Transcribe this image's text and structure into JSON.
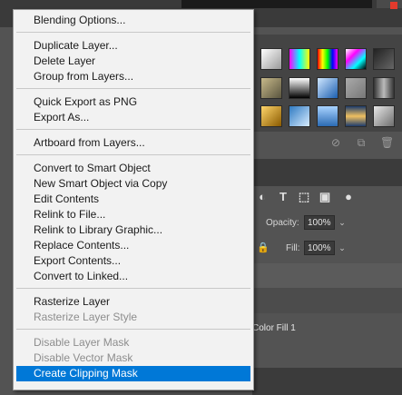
{
  "menu": {
    "groups": [
      [
        {
          "label": "Blending Options...",
          "enabled": true
        }
      ],
      [
        {
          "label": "Duplicate Layer...",
          "enabled": true
        },
        {
          "label": "Delete Layer",
          "enabled": true
        },
        {
          "label": "Group from Layers...",
          "enabled": true
        }
      ],
      [
        {
          "label": "Quick Export as PNG",
          "enabled": true
        },
        {
          "label": "Export As...",
          "enabled": true
        }
      ],
      [
        {
          "label": "Artboard from Layers...",
          "enabled": true
        }
      ],
      [
        {
          "label": "Convert to Smart Object",
          "enabled": true
        },
        {
          "label": "New Smart Object via Copy",
          "enabled": true
        },
        {
          "label": "Edit Contents",
          "enabled": true
        },
        {
          "label": "Relink to File...",
          "enabled": true
        },
        {
          "label": "Relink to Library Graphic...",
          "enabled": true
        },
        {
          "label": "Replace Contents...",
          "enabled": true
        },
        {
          "label": "Export Contents...",
          "enabled": true
        },
        {
          "label": "Convert to Linked...",
          "enabled": true
        }
      ],
      [
        {
          "label": "Rasterize Layer",
          "enabled": true
        },
        {
          "label": "Rasterize Layer Style",
          "enabled": false
        }
      ],
      [
        {
          "label": "Disable Layer Mask",
          "enabled": false
        },
        {
          "label": "Disable Vector Mask",
          "enabled": false
        },
        {
          "label": "Create Clipping Mask",
          "enabled": true,
          "selected": true
        }
      ]
    ]
  },
  "layers_panel": {
    "opacity_label": "Opacity:",
    "opacity_value": "100%",
    "fill_label": "Fill:",
    "fill_value": "100%",
    "layer_name": "Color Fill 1"
  }
}
